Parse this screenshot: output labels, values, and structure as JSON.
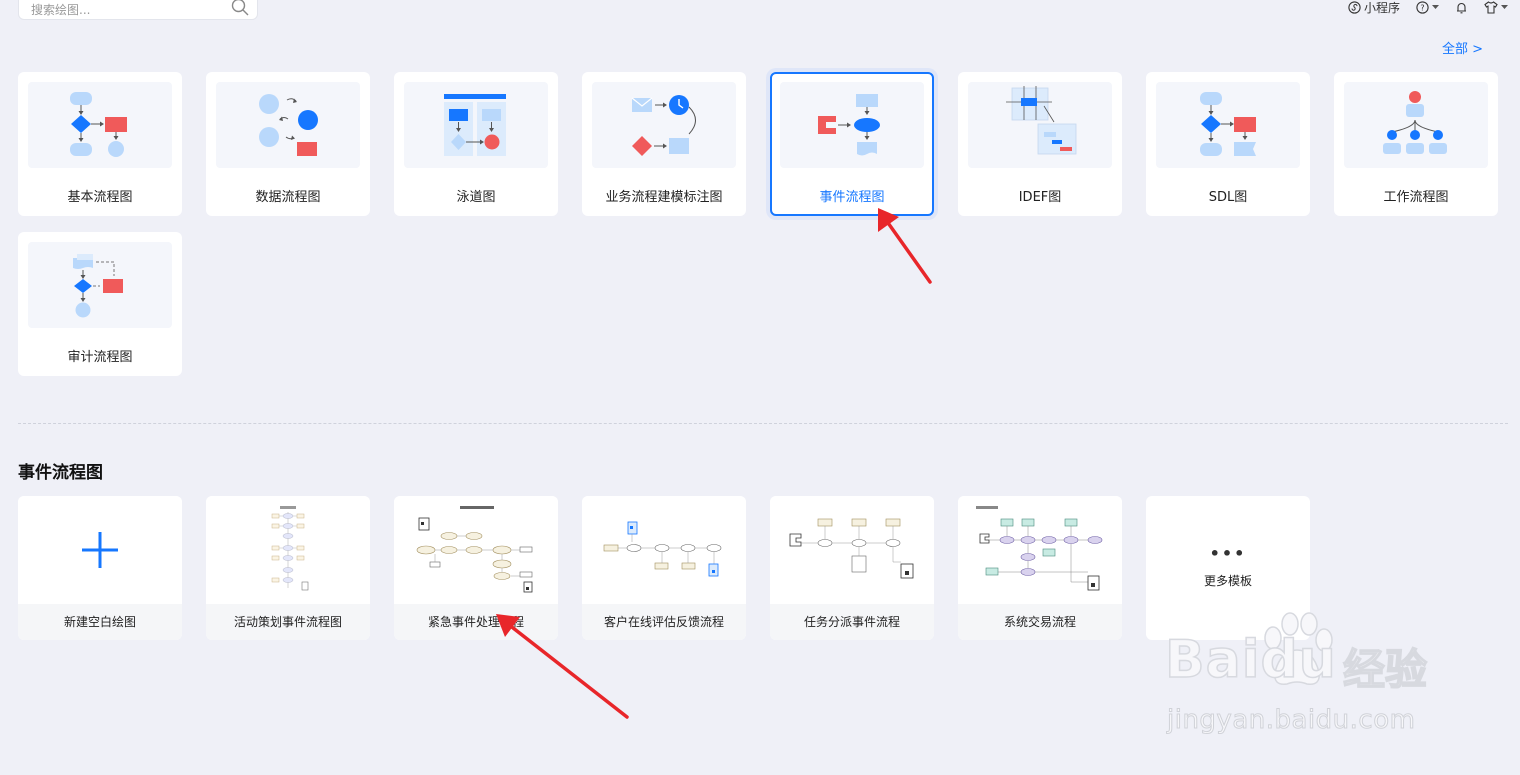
{
  "search": {
    "placeholder": "搜索绘图..."
  },
  "topbar": {
    "miniprogram": "小程序"
  },
  "all_link": "全部 >",
  "type_cards": [
    {
      "label": "基本流程图"
    },
    {
      "label": "数据流程图"
    },
    {
      "label": "泳道图"
    },
    {
      "label": "业务流程建模标注图"
    },
    {
      "label": "事件流程图",
      "selected": true
    },
    {
      "label": "IDEF图"
    },
    {
      "label": "SDL图"
    },
    {
      "label": "工作流程图"
    },
    {
      "label": "审计流程图"
    }
  ],
  "section": {
    "title": "事件流程图"
  },
  "templates": [
    {
      "label": "新建空白绘图"
    },
    {
      "label": "活动策划事件流程图"
    },
    {
      "label": "紧急事件处理流程"
    },
    {
      "label": "客户在线评估反馈流程"
    },
    {
      "label": "任务分派事件流程"
    },
    {
      "label": "系统交易流程"
    }
  ],
  "more": {
    "dots": "•••",
    "label": "更多模板"
  },
  "watermark": {
    "brand": "Baidu",
    "product": "经验",
    "url": "jingyan.baidu.com"
  },
  "colors": {
    "accent": "#1677ff",
    "light_blue": "#b9d8fb",
    "red": "#f05a5a",
    "arrow_red": "#e8262a"
  }
}
